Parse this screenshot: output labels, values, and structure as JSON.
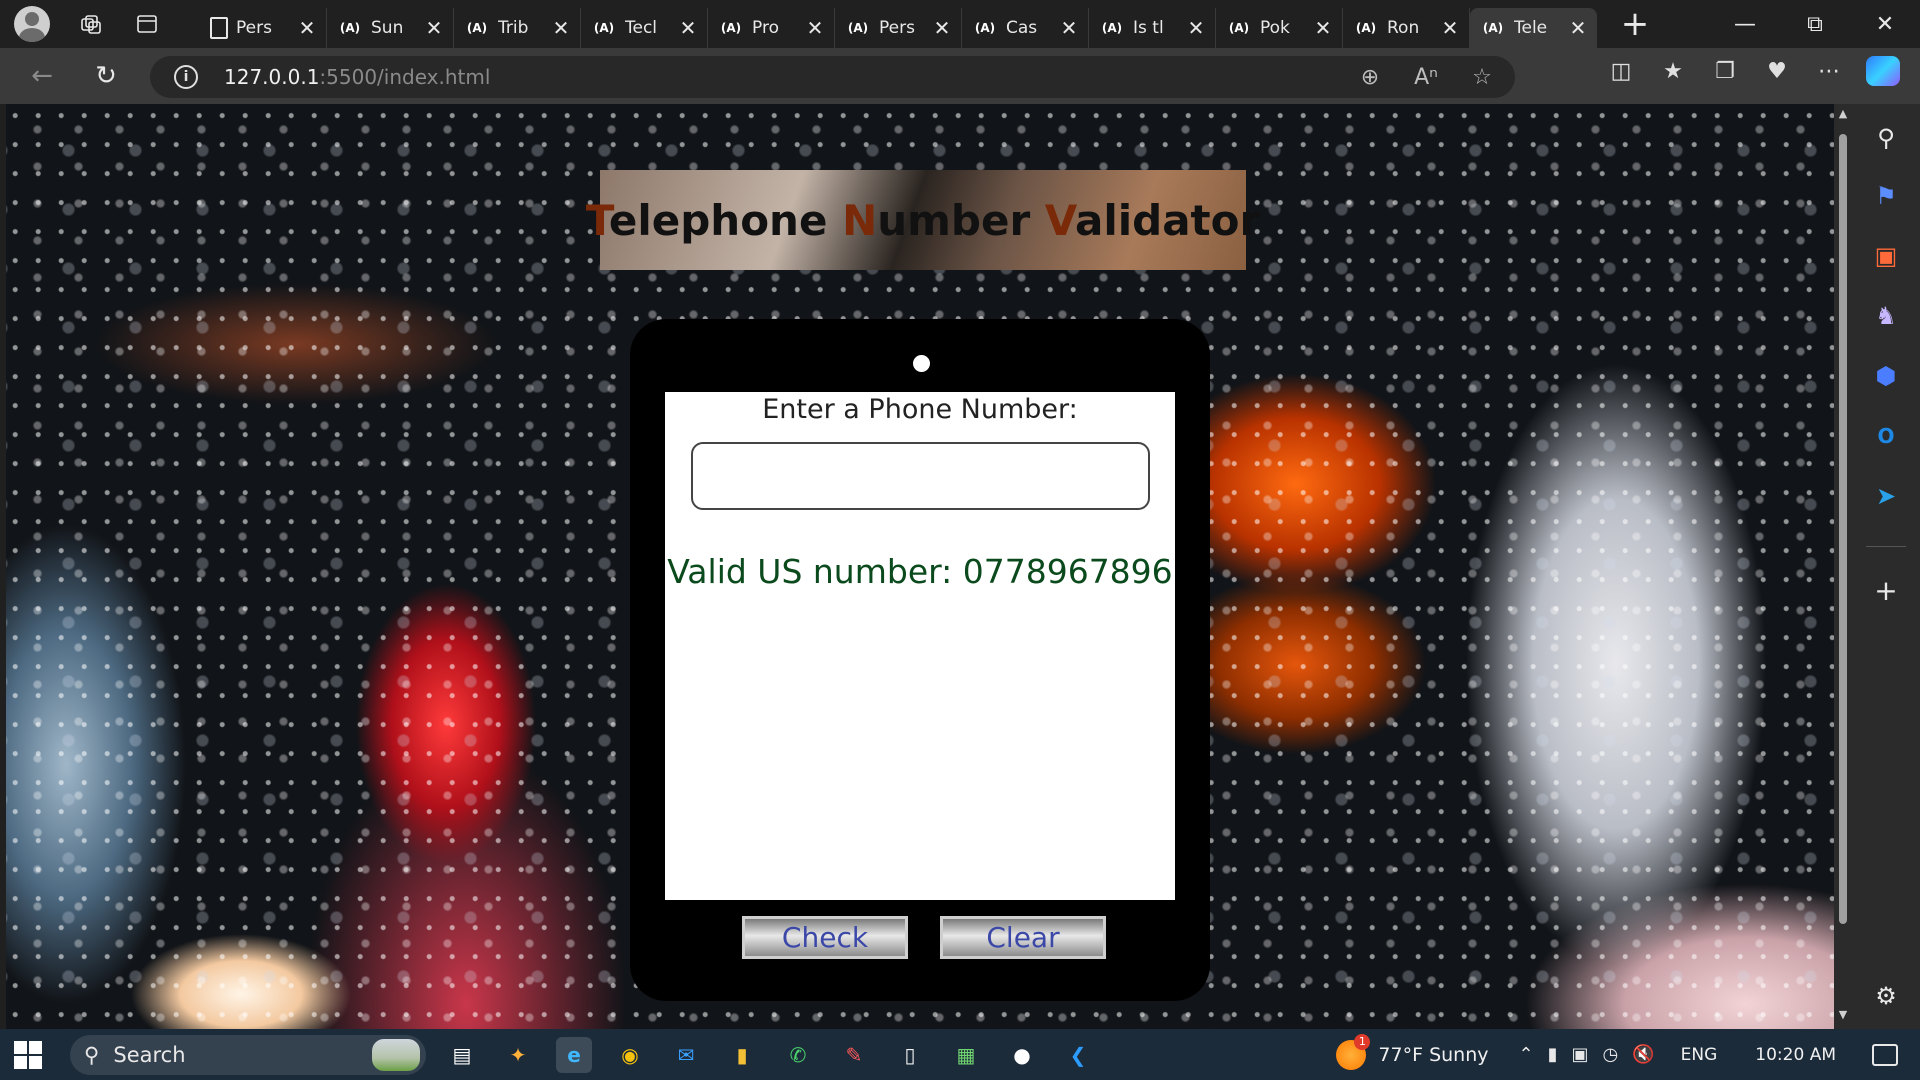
{
  "browser": {
    "tabs": [
      {
        "favicon": "page",
        "title": "Pers"
      },
      {
        "favicon": "(A)",
        "title": "Sun"
      },
      {
        "favicon": "(A)",
        "title": "Trib"
      },
      {
        "favicon": "(A)",
        "title": "Tecl"
      },
      {
        "favicon": "(A)",
        "title": "Pro"
      },
      {
        "favicon": "(A)",
        "title": "Pers"
      },
      {
        "favicon": "(A)",
        "title": "Cas"
      },
      {
        "favicon": "(A)",
        "title": "Is tl"
      },
      {
        "favicon": "(A)",
        "title": "Pok"
      },
      {
        "favicon": "(A)",
        "title": "Ron"
      },
      {
        "favicon": "(A)",
        "title": "Tele"
      }
    ],
    "active_tab": 10,
    "url_host": "127.0.0.1",
    "url_rest": ":5500/index.html"
  },
  "page": {
    "title_parts": [
      {
        "text": "T",
        "accent": true
      },
      {
        "text": "elephone ",
        "accent": false
      },
      {
        "text": "N",
        "accent": true
      },
      {
        "text": "umber ",
        "accent": false
      },
      {
        "text": "V",
        "accent": true
      },
      {
        "text": "alidator",
        "accent": false
      }
    ],
    "input_label": "Enter a Phone Number:",
    "input_value": "",
    "result_text": "Valid US number: 0778967896",
    "check_button": "Check",
    "clear_button": "Clear"
  },
  "colors": {
    "title_accent": "#7a2a08",
    "result": "#0b4a1c",
    "button_text": "#3b48a8"
  },
  "taskbar": {
    "search_placeholder": "Search",
    "weather_badge": "1",
    "weather": "77°F  Sunny",
    "language": "ENG",
    "time": "10:20 AM"
  }
}
